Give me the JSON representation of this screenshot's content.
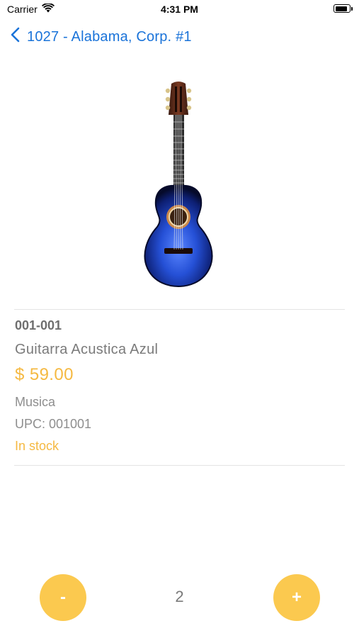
{
  "status_bar": {
    "carrier": "Carrier",
    "time": "4:31 PM",
    "battery_level": 0.9
  },
  "nav": {
    "back_icon": "chevron-left-icon",
    "title": "1027 - Alabama, Corp. #1"
  },
  "product": {
    "image_icon": "acoustic-guitar-image",
    "sku": "001-001",
    "name": "Guitarra Acustica Azul",
    "price": "$ 59.00",
    "category": "Musica",
    "upc": "UPC: 001001",
    "stock_status": "In stock"
  },
  "quantity": {
    "decrement_label": "-",
    "value": "2",
    "increment_label": "+"
  },
  "colors": {
    "accent": "#fbc94f",
    "price": "#f5b942",
    "link": "#1a73d9",
    "guitar_body": "#1c3fb8"
  }
}
